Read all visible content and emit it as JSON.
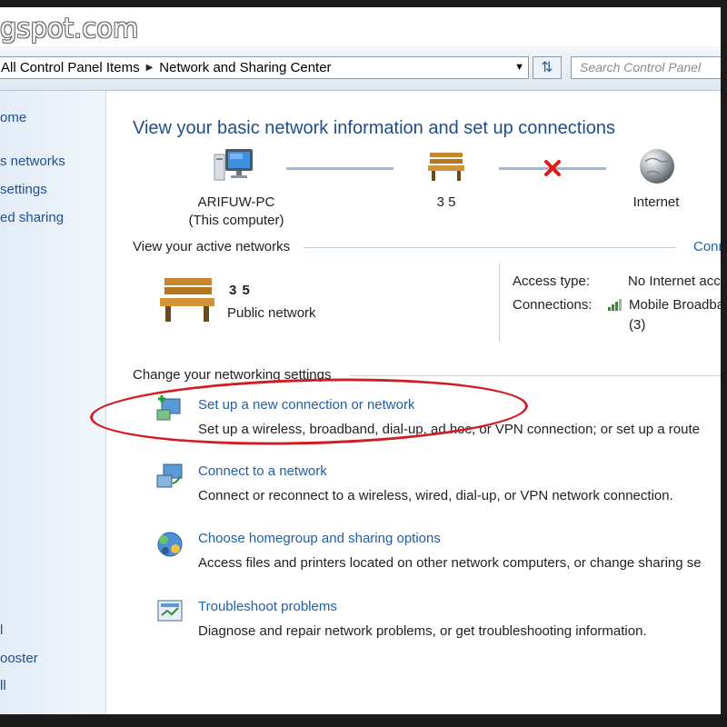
{
  "watermark": "gspot.com",
  "address_bar": {
    "crumbs": [
      "All Control Panel Items",
      "Network and Sharing Center"
    ],
    "search_placeholder": "Search Control Panel"
  },
  "sidebar": {
    "items": [
      "ome",
      "s networks",
      "settings",
      "ed sharing",
      "l",
      "ooster",
      "ll"
    ]
  },
  "main": {
    "title": "View your basic network information and set up connections",
    "map": {
      "computer_name": "ARIFUW-PC",
      "computer_sub": "(This computer)",
      "network_name": "3  5",
      "internet_label": "Internet"
    },
    "active_networks": {
      "heading": "View your active networks",
      "right_link": "Conn",
      "network_name": "3  5",
      "network_type": "Public network",
      "access_type_label": "Access type:",
      "access_type_value": "No Internet acc",
      "connections_label": "Connections:",
      "connections_value": "Mobile Broadba",
      "connections_value_2": "(3)"
    },
    "change_settings": {
      "heading": "Change your networking settings",
      "tasks": [
        {
          "title": "Set up a new connection or network",
          "desc": "Set up a wireless, broadband, dial-up, ad hoc, or VPN connection; or set up a route",
          "icon": "new-connection-icon"
        },
        {
          "title": "Connect to a network",
          "desc": "Connect or reconnect to a wireless, wired, dial-up, or VPN network connection.",
          "icon": "connect-network-icon"
        },
        {
          "title": "Choose homegroup and sharing options",
          "desc": "Access files and printers located on other network computers, or change sharing se",
          "icon": "homegroup-icon"
        },
        {
          "title": "Troubleshoot problems",
          "desc": "Diagnose and repair network problems, or get troubleshooting information.",
          "icon": "troubleshoot-icon"
        }
      ]
    }
  },
  "colors": {
    "link": "#1f5fa8",
    "title": "#1e4e8c",
    "highlight_ellipse": "#d11c24"
  }
}
